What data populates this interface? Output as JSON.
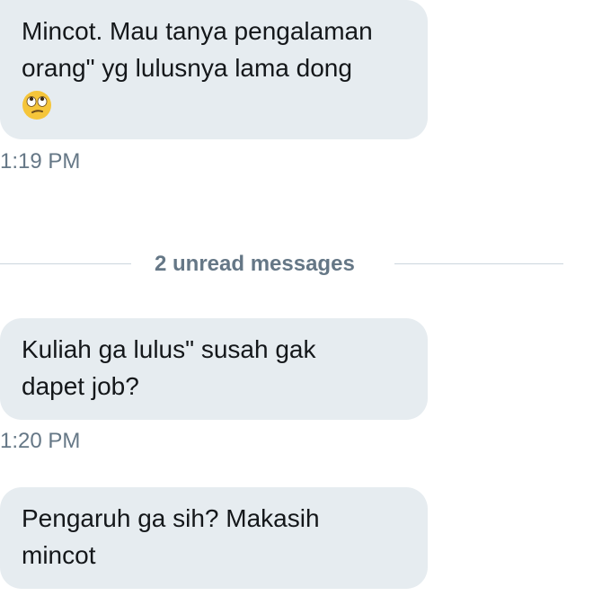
{
  "messages": [
    {
      "text": "Mincot. Mau tanya pengalaman\norang\" yg lulusnya lama dong",
      "emoji": "face-with-rolling-eyes-emoji",
      "timestamp": "1:19 PM"
    },
    {
      "text": "Kuliah ga lulus\" susah gak\ndapet job?",
      "timestamp": "1:20 PM"
    },
    {
      "text": "Pengaruh ga sih? Makasih\nmincot"
    }
  ],
  "divider": {
    "label": "2 unread messages"
  },
  "colors": {
    "bubble": "#e6ecf0",
    "text": "#14171a",
    "muted": "#657786",
    "divider_line": "#ccd6dd",
    "emoji_face": "#f5c53a"
  }
}
